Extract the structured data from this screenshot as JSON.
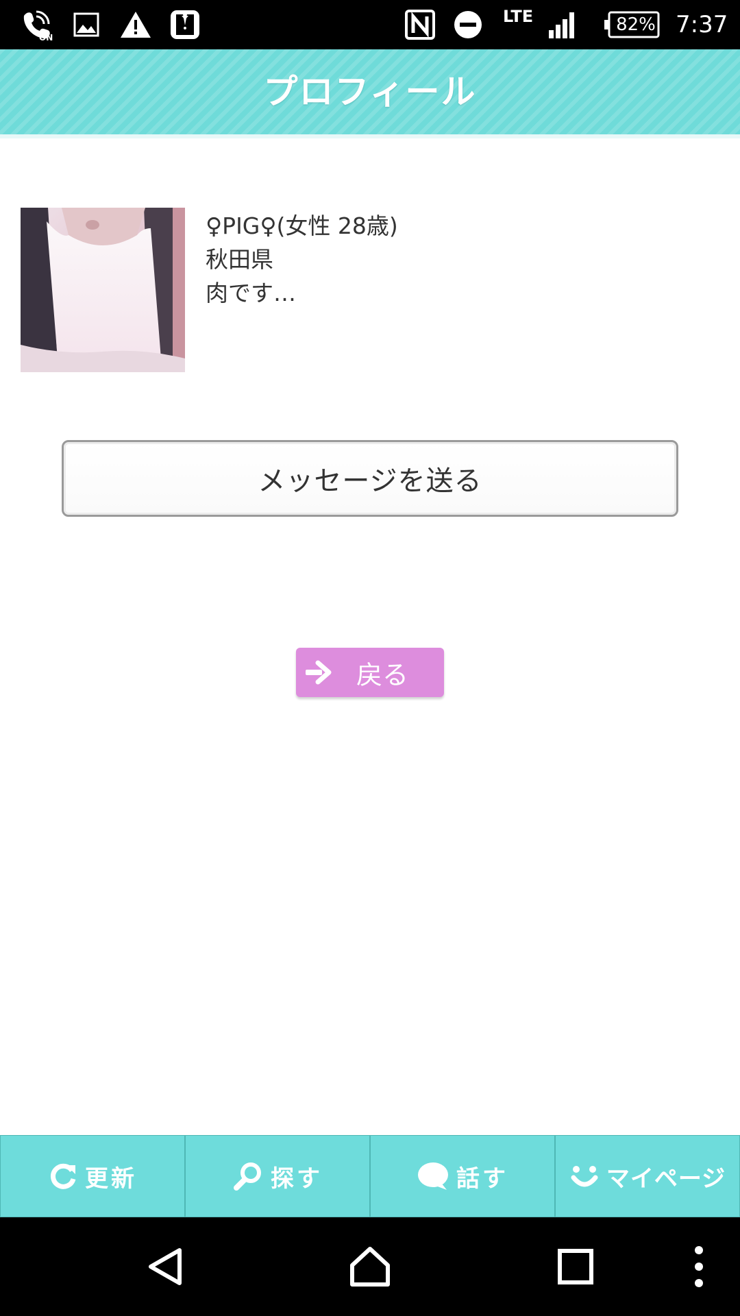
{
  "status_bar": {
    "battery": "82%",
    "network": "LTE",
    "time": "7:37",
    "icons": [
      "wifi-calling-icon",
      "image-icon",
      "warning-icon",
      "tuxedo-app-icon",
      "nfc-icon",
      "do-not-disturb-icon",
      "signal-icon",
      "battery-icon"
    ]
  },
  "header": {
    "title": "プロフィール"
  },
  "profile": {
    "name_line": "♀PIG♀(女性 28歳)",
    "location": "秋田県",
    "message": "肉です…"
  },
  "actions": {
    "send_message": "メッセージを送る",
    "back": "戻る"
  },
  "tabs": [
    {
      "label": "更新",
      "icon": "refresh-icon"
    },
    {
      "label": "探す",
      "icon": "search-icon"
    },
    {
      "label": "話す",
      "icon": "chat-bubble-icon"
    },
    {
      "label": "マイページ",
      "icon": "smile-icon"
    }
  ],
  "nav": [
    "back-icon",
    "home-icon",
    "recents-icon",
    "more-vert-icon"
  ],
  "colors": {
    "header": "#6fdbd9",
    "tab_bar": "#6edcdb",
    "back_button": "#dd8ddd"
  }
}
